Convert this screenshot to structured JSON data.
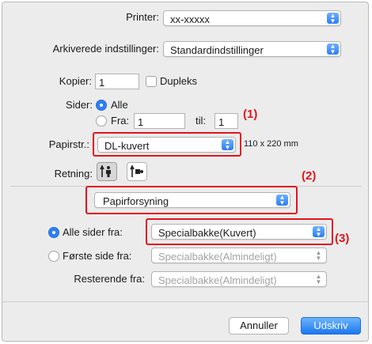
{
  "printer": {
    "label": "Printer:",
    "value": "xx-xxxxx"
  },
  "presets": {
    "label": "Arkiverede indstillinger:",
    "value": "Standardindstillinger"
  },
  "copies": {
    "label": "Kopier:",
    "value": "1",
    "duplex_label": "Dupleks",
    "duplex_checked": false
  },
  "pages": {
    "label": "Sider:",
    "all_label": "Alle",
    "from_label": "Fra:",
    "from_value": "1",
    "to_label": "til:",
    "to_value": "1",
    "selected": "all"
  },
  "paper_size": {
    "label": "Papirstr.:",
    "value": "DL-kuvert",
    "dimensions": "110 x 220 mm"
  },
  "orientation": {
    "label": "Retning:",
    "selected": "portrait"
  },
  "section": {
    "value": "Papirforsyning"
  },
  "paper_feed": {
    "all_pages": {
      "label": "Alle sider fra:",
      "value": "Specialbakke(Kuvert)",
      "selected": true
    },
    "first_page": {
      "label": "Første side fra:",
      "value": "Specialbakke(Almindeligt)",
      "selected": false
    },
    "remaining": {
      "label": "Resterende fra:",
      "value": "Specialbakke(Almindeligt)"
    }
  },
  "buttons": {
    "cancel": "Annuller",
    "print": "Udskriv"
  },
  "callouts": [
    "(1)",
    "(2)",
    "(3)"
  ],
  "colors": {
    "highlight": "#e2141b",
    "accent": "#2f7ef6"
  }
}
